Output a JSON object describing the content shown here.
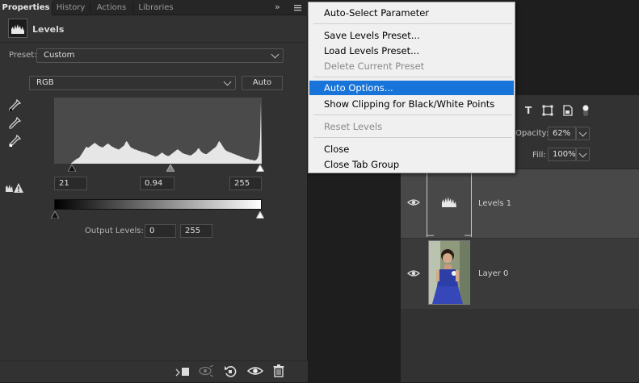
{
  "tabs": [
    {
      "label": "Properties",
      "active": true
    },
    {
      "label": "History",
      "active": false
    },
    {
      "label": "Actions",
      "active": false
    },
    {
      "label": "Libraries",
      "active": false
    }
  ],
  "panel": {
    "title": "Levels",
    "preset_label": "Preset:",
    "preset_value": "Custom",
    "channel_value": "RGB",
    "auto_label": "Auto",
    "input_black": "21",
    "input_gamma": "0.94",
    "input_white": "255",
    "output_label": "Output Levels:",
    "output_black": "0",
    "output_white": "255"
  },
  "menu": {
    "items": [
      {
        "label": "Auto-Select Parameter",
        "disabled": false,
        "highlighted": false
      },
      {
        "label": "Save Levels Preset...",
        "disabled": false,
        "highlighted": false
      },
      {
        "label": "Load Levels Preset...",
        "disabled": false,
        "highlighted": false
      },
      {
        "label": "Delete Current Preset",
        "disabled": true,
        "highlighted": false
      },
      {
        "label": "Auto Options...",
        "disabled": false,
        "highlighted": true
      },
      {
        "label": "Show Clipping for Black/White Points",
        "disabled": false,
        "highlighted": false
      },
      {
        "label": "Reset Levels",
        "disabled": true,
        "highlighted": false
      },
      {
        "label": "Close",
        "disabled": false,
        "highlighted": false
      },
      {
        "label": "Close Tab Group",
        "disabled": false,
        "highlighted": false
      }
    ]
  },
  "layers": {
    "opacity_label": "Opacity:",
    "opacity_value": "62%",
    "fill_label": "Fill:",
    "fill_value": "100%",
    "items": [
      {
        "name": "Levels 1"
      },
      {
        "name": "Layer 0"
      }
    ]
  },
  "histogram": {
    "values": [
      0,
      0,
      0,
      0,
      0,
      0,
      0,
      0,
      0,
      0,
      0,
      0,
      0,
      0,
      0,
      0,
      0,
      0,
      0,
      0,
      0,
      1,
      2,
      3,
      4,
      5,
      6,
      7,
      8,
      8,
      9,
      10,
      12,
      14,
      16,
      18,
      20,
      22,
      24,
      26,
      26,
      25,
      25,
      26,
      27,
      28,
      29,
      30,
      31,
      32,
      32,
      31,
      30,
      29,
      28,
      27,
      27,
      26,
      26,
      25,
      26,
      27,
      28,
      29,
      30,
      31,
      31,
      30,
      29,
      28,
      27,
      26,
      26,
      25,
      24,
      24,
      23,
      23,
      22,
      22,
      23,
      24,
      25,
      26,
      27,
      28,
      30,
      33,
      35,
      34,
      32,
      30,
      28,
      26,
      25,
      24,
      24,
      23,
      22,
      22,
      22,
      21,
      21,
      20,
      20,
      19,
      19,
      18,
      18,
      18,
      17,
      17,
      17,
      16,
      16,
      15,
      15,
      14,
      14,
      13,
      13,
      12,
      12,
      11,
      11,
      12,
      12,
      13,
      14,
      15,
      16,
      17,
      17,
      16,
      15,
      14,
      13,
      13,
      12,
      12,
      12,
      13,
      14,
      15,
      16,
      17,
      18,
      19,
      20,
      21,
      22,
      22,
      21,
      20,
      19,
      18,
      17,
      16,
      16,
      15,
      15,
      14,
      14,
      14,
      13,
      13,
      13,
      13,
      14,
      15,
      16,
      17,
      18,
      19,
      21,
      23,
      24,
      23,
      21,
      19,
      18,
      17,
      16,
      16,
      15,
      15,
      15,
      16,
      17,
      18,
      19,
      20,
      21,
      22,
      23,
      24,
      25,
      26,
      28,
      30,
      33,
      35,
      34,
      32,
      30,
      28,
      26,
      24,
      22,
      21,
      20,
      19,
      19,
      18,
      18,
      17,
      17,
      16,
      16,
      15,
      15,
      14,
      14,
      13,
      13,
      12,
      12,
      11,
      11,
      10,
      10,
      9,
      9,
      8,
      8,
      8,
      7,
      7,
      7,
      6,
      6,
      6,
      6,
      5,
      5,
      5,
      6,
      7,
      9,
      12,
      20,
      40,
      95
    ],
    "max": 100
  }
}
